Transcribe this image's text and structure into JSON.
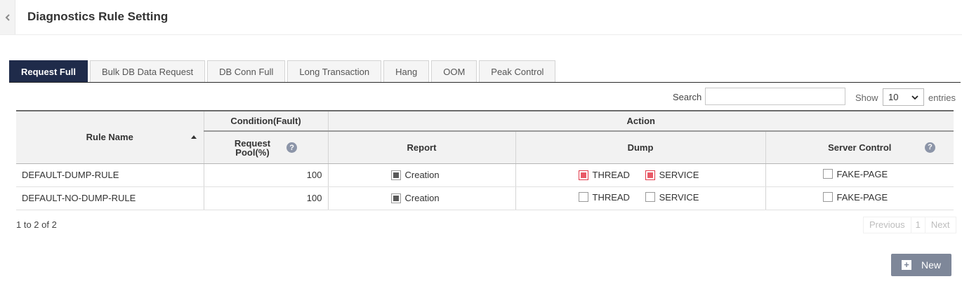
{
  "header": {
    "title": "Diagnostics Rule Setting",
    "back_icon": "chevron-left-icon"
  },
  "tabs": [
    {
      "label": "Request Full",
      "active": true
    },
    {
      "label": "Bulk DB Data Request",
      "active": false
    },
    {
      "label": "DB Conn Full",
      "active": false
    },
    {
      "label": "Long Transaction",
      "active": false
    },
    {
      "label": "Hang",
      "active": false
    },
    {
      "label": "OOM",
      "active": false
    },
    {
      "label": "Peak Control",
      "active": false
    }
  ],
  "toolbar": {
    "search_label": "Search",
    "search_value": "",
    "show_label": "Show",
    "show_value": "10",
    "entries_label": "entries"
  },
  "table": {
    "headers": {
      "rule_name": "Rule Name",
      "condition_group": "Condition(Fault)",
      "action_group": "Action",
      "request_pool_line1": "Request",
      "request_pool_line2": "Pool(%)",
      "report": "Report",
      "dump": "Dump",
      "server_control": "Server Control"
    },
    "rows": [
      {
        "name": "DEFAULT-DUMP-RULE",
        "pool": "100",
        "report_label": "Creation",
        "report_checked": true,
        "thread_label": "THREAD",
        "thread_checked": true,
        "service_label": "SERVICE",
        "service_checked": true,
        "fake_label": "FAKE-PAGE",
        "fake_checked": false
      },
      {
        "name": "DEFAULT-NO-DUMP-RULE",
        "pool": "100",
        "report_label": "Creation",
        "report_checked": true,
        "thread_label": "THREAD",
        "thread_checked": false,
        "service_label": "SERVICE",
        "service_checked": false,
        "fake_label": "FAKE-PAGE",
        "fake_checked": false
      }
    ]
  },
  "footer": {
    "info": "1 to 2 of 2",
    "prev_label": "Previous",
    "page": "1",
    "next_label": "Next"
  },
  "new_button": {
    "label": "New"
  },
  "colors": {
    "active_tab": "#1f2b4a",
    "checked_red": "#e95a67",
    "button": "#7e8799"
  }
}
